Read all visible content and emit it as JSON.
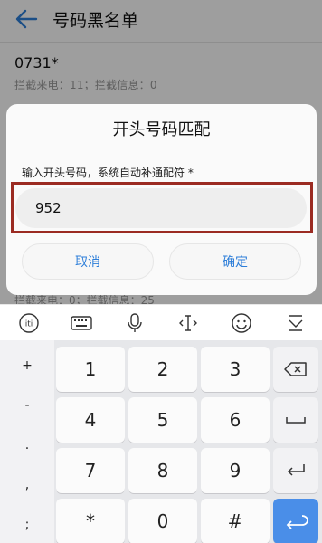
{
  "appbar": {
    "title": "号码黑名单"
  },
  "list": {
    "item1": {
      "number": "0731*",
      "subtitle": "拦截来电：11；拦截信息：0"
    },
    "item2": {
      "subtitle": "拦截来电：0；拦截信息：25"
    }
  },
  "dialog": {
    "title": "开头号码匹配",
    "hint": "输入开头号码，系统自动补通配符 *",
    "input_value": "952",
    "cancel_label": "取消",
    "ok_label": "确定"
  },
  "keyboard": {
    "symbols": [
      "+",
      "-",
      ".",
      ",",
      ";"
    ],
    "digits": [
      "1",
      "2",
      "3",
      "4",
      "5",
      "6",
      "7",
      "8",
      "9",
      "*",
      "0",
      "#"
    ]
  },
  "colors": {
    "accent": "#2d7ed9",
    "highlight_outline": "#9b2b22",
    "enter_key": "#4a8ee8"
  }
}
